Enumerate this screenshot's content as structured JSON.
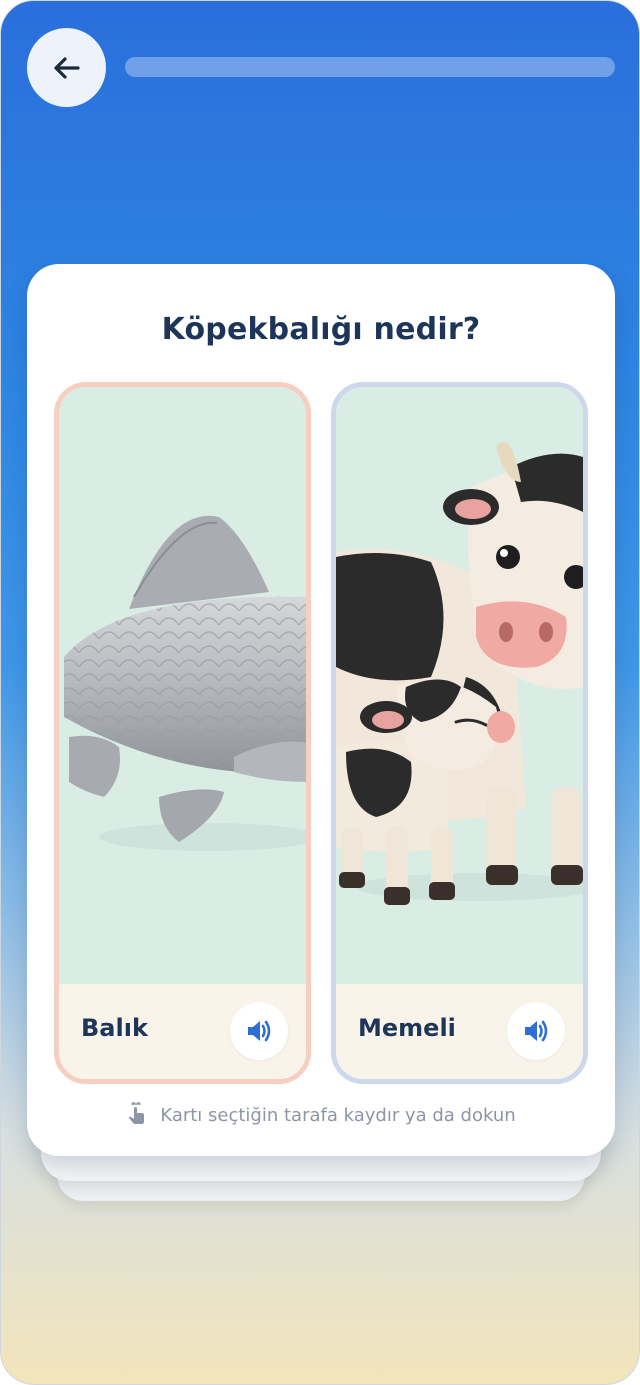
{
  "header": {
    "back_icon": "arrow-left-icon",
    "progress": 0
  },
  "quiz": {
    "question": "Köpekbalığı nedir?",
    "options": [
      {
        "label": "Balık",
        "image": "fish-illustration",
        "audio_icon": "speaker-icon"
      },
      {
        "label": "Memeli",
        "image": "cow-and-calf-illustration",
        "audio_icon": "speaker-icon"
      }
    ],
    "hint": "Kartı seçtiğin tarafa kaydır ya da dokun",
    "hint_icon": "swipe-hand-icon"
  },
  "colors": {
    "accent": "#2f86e3",
    "text_dark": "#1d3558",
    "left_border": "#f6cfc0",
    "right_border": "#cdd8ec",
    "speaker": "#2f6fd0"
  }
}
